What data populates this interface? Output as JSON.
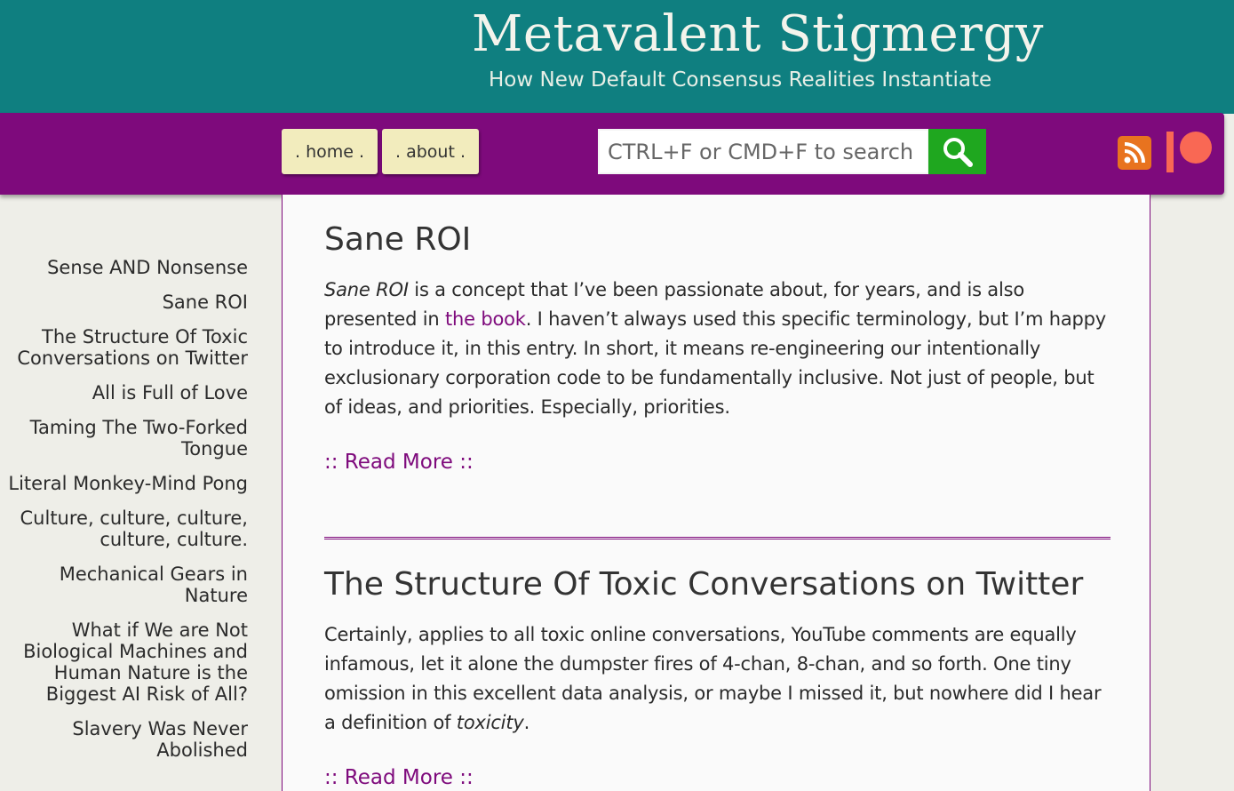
{
  "header": {
    "title": "Metavalent Stigmergy",
    "tagline": "How New Default Consensus Realities Instantiate"
  },
  "nav": {
    "home_label": ". home .",
    "about_label": ". about .",
    "search_placeholder": "CTRL+F or CMD+F to search",
    "search_icon": "search-icon",
    "rss_icon": "rss-icon",
    "patreon_icon": "patreon-icon"
  },
  "sidebar": {
    "items": [
      {
        "label": "Sense AND Nonsense"
      },
      {
        "label": "Sane ROI"
      },
      {
        "label": "The Structure Of Toxic Conversations on Twitter"
      },
      {
        "label": "All is Full of Love"
      },
      {
        "label": "Taming The Two-Forked Tongue"
      },
      {
        "label": "Literal Monkey-Mind Pong"
      },
      {
        "label": "Culture, culture, culture, culture, culture."
      },
      {
        "label": "Mechanical Gears in Nature"
      },
      {
        "label": "What if We are Not Biological Machines and Human Nature is the Biggest AI Risk of All?"
      },
      {
        "label": "Slavery Was Never Abolished"
      }
    ]
  },
  "posts": [
    {
      "title": "Sane ROI",
      "body_em": "Sane ROI",
      "body_part1": " is a concept that I’ve been passionate about, for years, and is also presented in ",
      "body_link": "the book",
      "body_part2": ". I haven’t always used this specific terminology, but I’m happy to introduce it, in this entry. In short, it means re-engineering our intentionally exclusionary corporation code to be fundamentally inclusive. Not just of people, but of ideas, and priorities. Especially, priorities.",
      "read_more": ":: Read More ::"
    },
    {
      "title": "The Structure Of Toxic Conversations on Twitter",
      "body_part1": "Certainly, applies to all toxic online conversations, YouTube comments are equally infamous, let it alone the dumpster fires of 4-chan, 8-chan, and so forth. One tiny omission in this excellent data analysis, or maybe I missed it, but nowhere did I hear a definition of ",
      "body_em": "toxicity",
      "body_part2": ".",
      "read_more": ":: Read More ::"
    }
  ],
  "colors": {
    "header_teal": "#0f7f80",
    "nav_purple": "#7e0a7c",
    "button_cream": "#f2ecbd",
    "search_green": "#1fa71f",
    "rss_orange": "#e8731f",
    "patreon_red": "#f96854"
  }
}
